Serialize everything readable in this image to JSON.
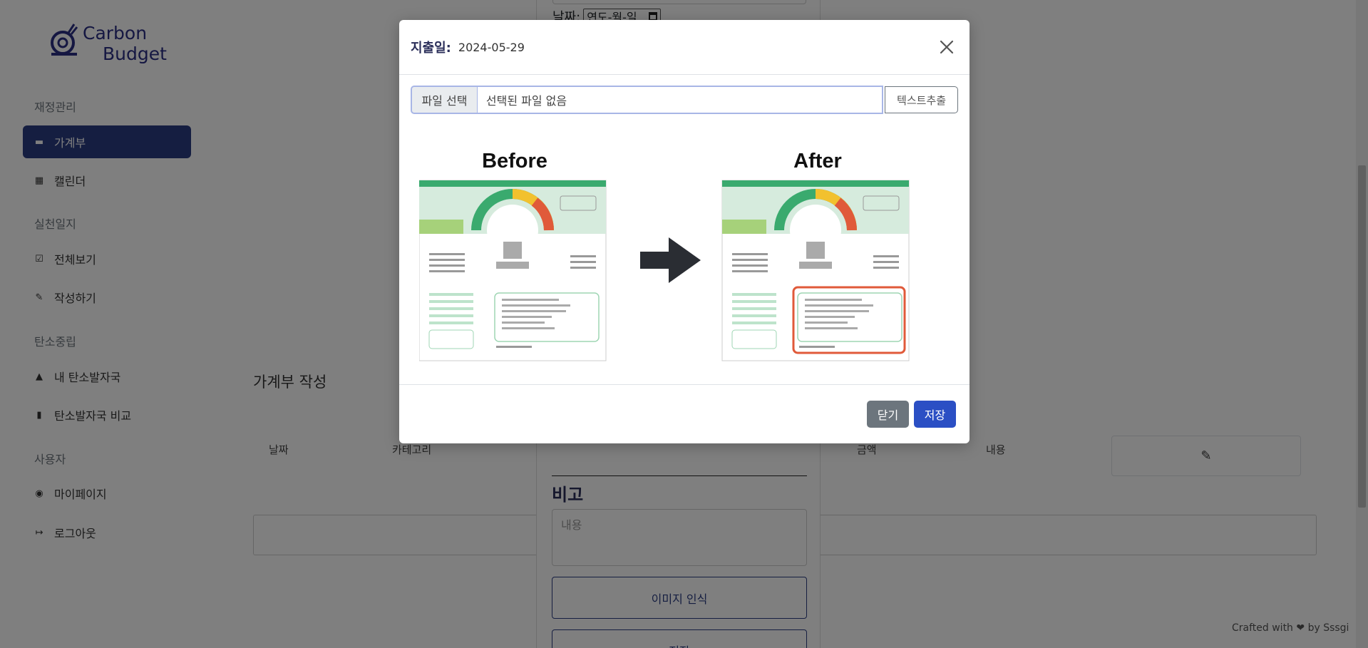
{
  "sidebar": {
    "logo_line1": "Carbon",
    "logo_line2": "Budget",
    "sections": [
      {
        "title": "재정관리",
        "items": [
          {
            "label": "가계부",
            "icon": "wallet-icon",
            "active": true
          },
          {
            "label": "캘린더",
            "icon": "calendar-icon",
            "active": false
          }
        ]
      },
      {
        "title": "실천일지",
        "items": [
          {
            "label": "전체보기",
            "icon": "list-icon",
            "active": false
          },
          {
            "label": "작성하기",
            "icon": "pencil-icon",
            "active": false
          }
        ]
      },
      {
        "title": "탄소중립",
        "items": [
          {
            "label": "내 탄소발자국",
            "icon": "footprint-icon",
            "active": false
          },
          {
            "label": "탄소발자국 비교",
            "icon": "bar-chart-icon",
            "active": false
          }
        ]
      },
      {
        "title": "사용자",
        "items": [
          {
            "label": "마이페이지",
            "icon": "user-icon",
            "active": false
          },
          {
            "label": "로그아웃",
            "icon": "logout-icon",
            "active": false
          }
        ]
      }
    ]
  },
  "background": {
    "section_title": "가계부 작성",
    "columns": [
      "날짜",
      "카테고리",
      "금액",
      "내용"
    ],
    "edit_icon": "pencil-icon",
    "footer_credit": "Crafted with ❤ by Sssgi"
  },
  "form": {
    "date_label": "날짜:",
    "date_placeholder": "연도-월-일",
    "remark_title": "비고",
    "remark_placeholder": "내용",
    "image_button": "이미지 인식",
    "save_button": "저장"
  },
  "modal": {
    "title_label": "지출일:",
    "title_value": "2024-05-29",
    "file_button": "파일 선택",
    "file_name": "선택된 파일 없음",
    "extract_button": "텍스트추출",
    "before_label": "Before",
    "after_label": "After",
    "close_button": "닫기",
    "save_button": "저장"
  },
  "colors": {
    "brand": "#2b3c82",
    "primary": "#2b4fc4",
    "secondary": "#6c757d",
    "highlight": "#e05a3a",
    "receipt_green": "#3aaa6e"
  }
}
